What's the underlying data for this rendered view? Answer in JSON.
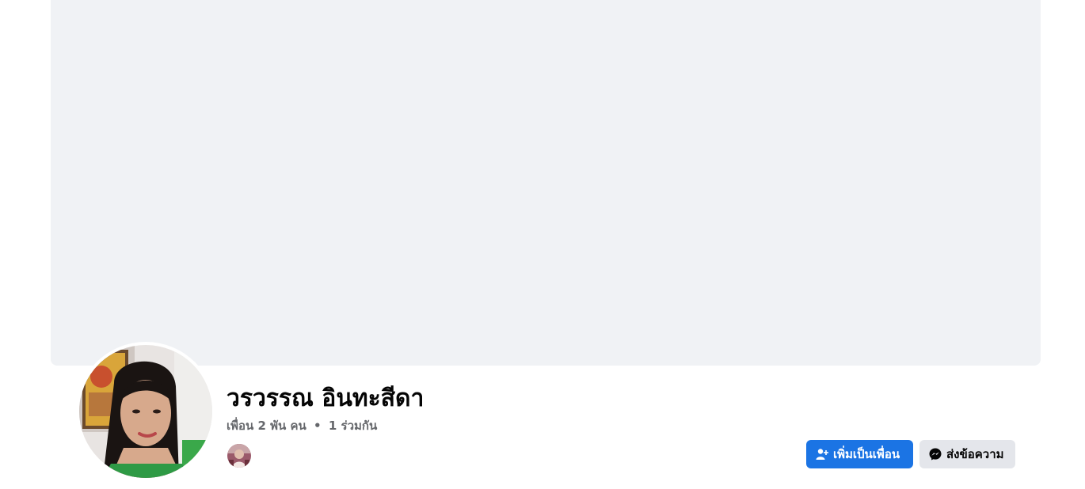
{
  "profile": {
    "name": "วรวรรณ อินทะสีดา",
    "friends_text": "เพื่อน 2 พัน คน",
    "separator": "•",
    "mutual_text": "1 ร่วมกัน"
  },
  "actions": {
    "add_friend_label": "เพิ่มเป็นเพื่อน",
    "add_friend_icon": "add-person-icon",
    "message_label": "ส่งข้อความ",
    "message_icon": "messenger-icon"
  },
  "colors": {
    "cover_placeholder": "#f0f2f5",
    "primary_button": "#1b74e4",
    "secondary_button": "#e4e6eb",
    "meta_text": "#65676b"
  }
}
